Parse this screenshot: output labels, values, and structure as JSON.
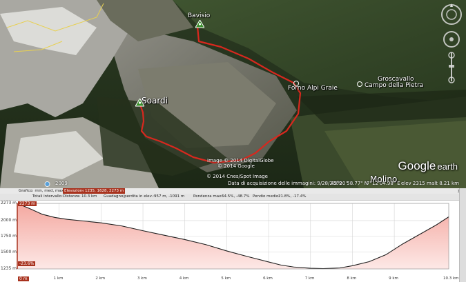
{
  "map": {
    "places": [
      {
        "name": "Bavisio",
        "kind": "hiker"
      },
      {
        "name": "Soardi",
        "kind": "hiker"
      },
      {
        "name": "Forno Alpi Graie",
        "kind": "pin"
      },
      {
        "name": "Groscavallo",
        "kind": "label"
      },
      {
        "name": "Campo della Pietra",
        "kind": "pin"
      },
      {
        "name": "Molino",
        "kind": "label"
      }
    ],
    "credits": {
      "line1": "Image © 2014 DigitalGlobe",
      "line2": "© 2014 Google",
      "line3": "© 2014 Cnes/Spot Image"
    },
    "logo": {
      "google": "Google",
      "earth": "earth"
    },
    "status": {
      "year": "2009",
      "imagery_date": "Data di acquisizione delle immagini: 9/28/2009",
      "lat": "45°20'58.77\" N",
      "lon": "7°12'04.98\" E",
      "elev": "elev  2315 m",
      "eye": "alt  8.21 km"
    },
    "icons": {
      "hiker": "hiker-icon",
      "pin": "place-pin-icon",
      "nav": "navigation-compass-icon"
    },
    "colors": {
      "track": "#d8281e"
    }
  },
  "profile": {
    "stats": {
      "graph_label": "Grafico: min, med, max",
      "elevation_label": "Elevazione:",
      "elevation_value": "1235, 1628, 2273 m",
      "totals_label": "Totali intervallo:",
      "distance_label": "Distanza:",
      "distance_value": "10.3 km",
      "gain_label": "Guadagno/perdita in elev.:",
      "gain_value": "957 m, -1091 m",
      "slope_max_label": "Pendenza max:",
      "slope_max_value": "64.5%, -48.7%",
      "slope_avg_label": "Pendio medio:",
      "slope_avg_value": "21.8%, -17.4%"
    },
    "close_icon": "close-icon",
    "marker_labels": {
      "max": "2273 m",
      "min": "-23.6%",
      "origin": "0 m"
    }
  },
  "chart_data": {
    "type": "area",
    "title": "",
    "xlabel": "",
    "ylabel": "",
    "x_unit": "km",
    "y_unit": "m",
    "xlim": [
      0,
      10.3
    ],
    "ylim": [
      1235,
      2273
    ],
    "yticks": [
      "2273 m",
      "2000 m",
      "1750 m",
      "1500 m",
      "1235 m"
    ],
    "xticks": [
      "1 km",
      "2 km",
      "3 km",
      "4 km",
      "5 km",
      "6 km",
      "7 km",
      "8 km",
      "9 km",
      "10.3 km"
    ],
    "grid": true,
    "series": [
      {
        "x": [
          0,
          0.3,
          0.6,
          0.9,
          1.2,
          1.5,
          2.0,
          2.5,
          3.0,
          3.5,
          4.0,
          4.5,
          5.0,
          5.5,
          6.0,
          6.3,
          6.6,
          7.0,
          7.3,
          7.7,
          8.0,
          8.4,
          8.8,
          9.2,
          9.6,
          10.0,
          10.3
        ],
        "y": [
          2273,
          2190,
          2100,
          2050,
          2020,
          2000,
          1965,
          1915,
          1840,
          1770,
          1700,
          1620,
          1520,
          1430,
          1345,
          1295,
          1265,
          1245,
          1240,
          1250,
          1285,
          1350,
          1460,
          1630,
          1780,
          1930,
          2060
        ]
      }
    ],
    "colors": {
      "line": "#1e1e1e",
      "fill_top": "#f4a8a0",
      "fill_bottom": "#fde8e6"
    }
  }
}
